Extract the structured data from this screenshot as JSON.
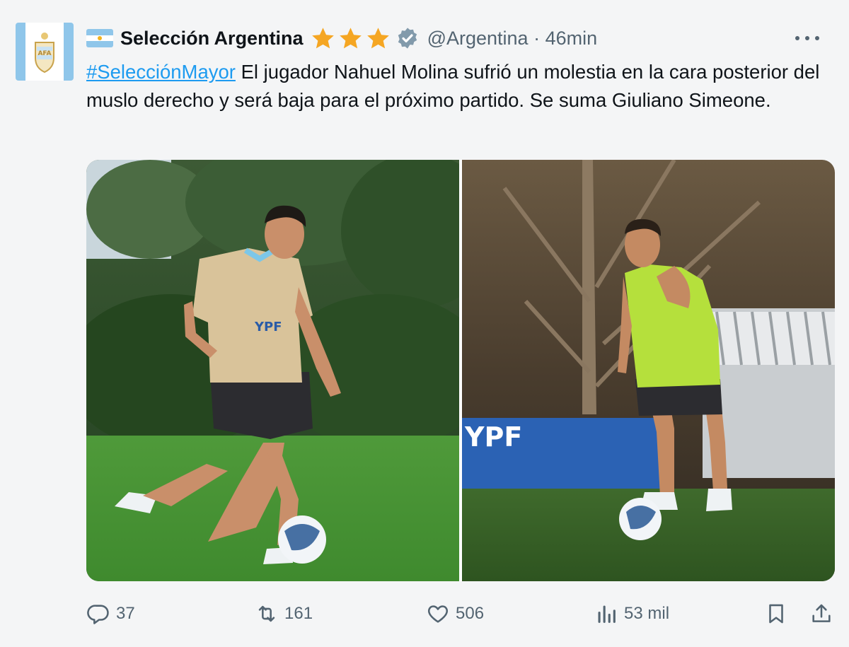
{
  "account": {
    "display_name": "Selección Argentina",
    "handle": "@Argentina",
    "separator": "·",
    "time": "46min",
    "stars": 3,
    "verified": true
  },
  "tweet": {
    "hashtag": "#SelecciónMayor",
    "text": " El jugador Nahuel Molina sufrió un molestia en la cara posterior del muslo derecho y será baja para el próximo partido. Se suma Giuliano Simeone."
  },
  "media": [
    {
      "icon": "photo-training-player-left",
      "kit_text": "YPF"
    },
    {
      "icon": "photo-training-player-right",
      "board_text": "YPF"
    }
  ],
  "actions": {
    "replies": "37",
    "retweets": "161",
    "likes": "506",
    "views": "53 mil"
  },
  "colors": {
    "link": "#1d9bf0",
    "secondary_text": "#536471",
    "star": "#f5a623",
    "verified_badge": "#829aab",
    "flag_blue": "#8fc6ea"
  }
}
